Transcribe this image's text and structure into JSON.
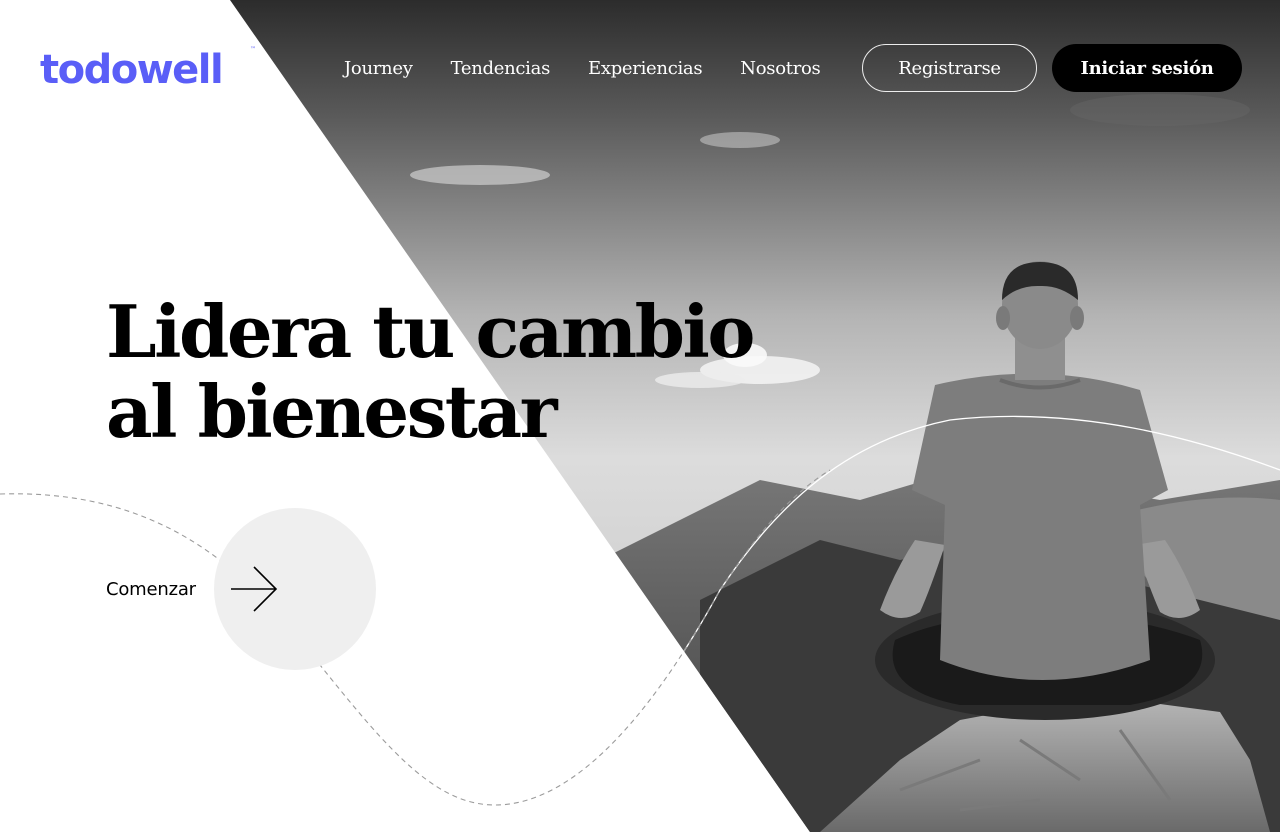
{
  "brand": {
    "logo_text": "todowell",
    "trademark": "™",
    "logo_color": "#5a5ef7"
  },
  "nav": {
    "items": [
      {
        "label": "Journey"
      },
      {
        "label": "Tendencias"
      },
      {
        "label": "Experiencias"
      },
      {
        "label": "Nosotros"
      }
    ]
  },
  "auth": {
    "register_label": "Registrarse",
    "login_label": "Iniciar sesión"
  },
  "hero": {
    "headline_line1": "Lidera tu cambio",
    "headline_line2": "al bienestar",
    "cta_label": "Comenzar",
    "cta_icon": "arrow-right-icon",
    "image_subject": "man meditating on a rock overlooking mountains, grayscale photo"
  },
  "colors": {
    "accent": "#5a5ef7",
    "text": "#000000",
    "button_dark": "#000000",
    "cta_circle": "#efefef"
  }
}
